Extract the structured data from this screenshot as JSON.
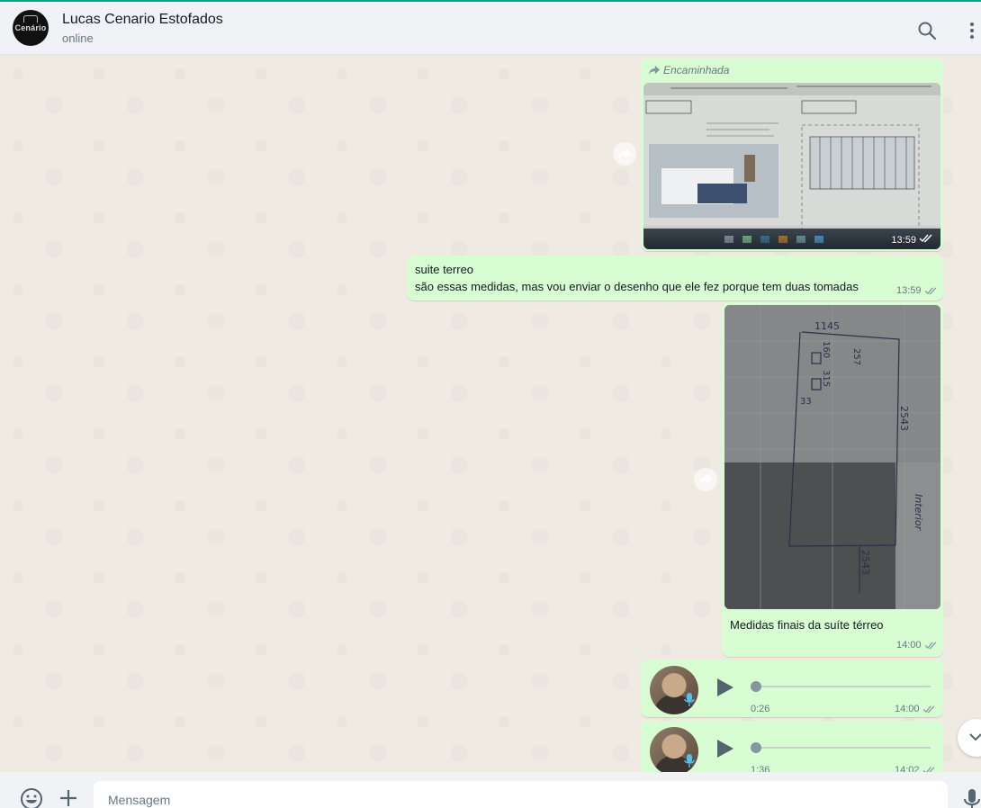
{
  "chat": {
    "name": "Lucas Cenario Estofados",
    "status": "online",
    "avatar_text": "Cenário"
  },
  "messages": {
    "forwarded_image": {
      "forwarded_label": "Encaminhada",
      "time": "13:59"
    },
    "text_message": {
      "line1": "suite terreo",
      "line2": "são essas medidas, mas vou enviar o desenho que ele fez porque tem duas tomadas",
      "time": "13:59"
    },
    "image_caption": {
      "caption": "Medidas finais da suíte térreo",
      "time": "14:00",
      "sketch_labels": [
        "1145",
        "160",
        "257",
        "315",
        "33",
        "2543",
        "2543",
        "Interior"
      ]
    },
    "voice_1": {
      "duration": "0:26",
      "time": "14:00"
    },
    "voice_2": {
      "duration": "1:36",
      "time": "14:02"
    }
  },
  "footer": {
    "placeholder": "Mensagem"
  },
  "icons": {
    "search": "search-icon",
    "menu": "menu-icon",
    "forward": "forward-icon",
    "read_receipt": "double-check-icon",
    "play": "play-icon",
    "mic": "mic-icon",
    "emoji": "emoji-icon",
    "attach": "plus-icon",
    "scroll": "chevron-down-icon"
  },
  "colors": {
    "accent": "#00a884",
    "outgoing_bubble": "#d9fdd3",
    "wallpaper": "#efeae2",
    "header_bg": "#f0f2f5"
  }
}
